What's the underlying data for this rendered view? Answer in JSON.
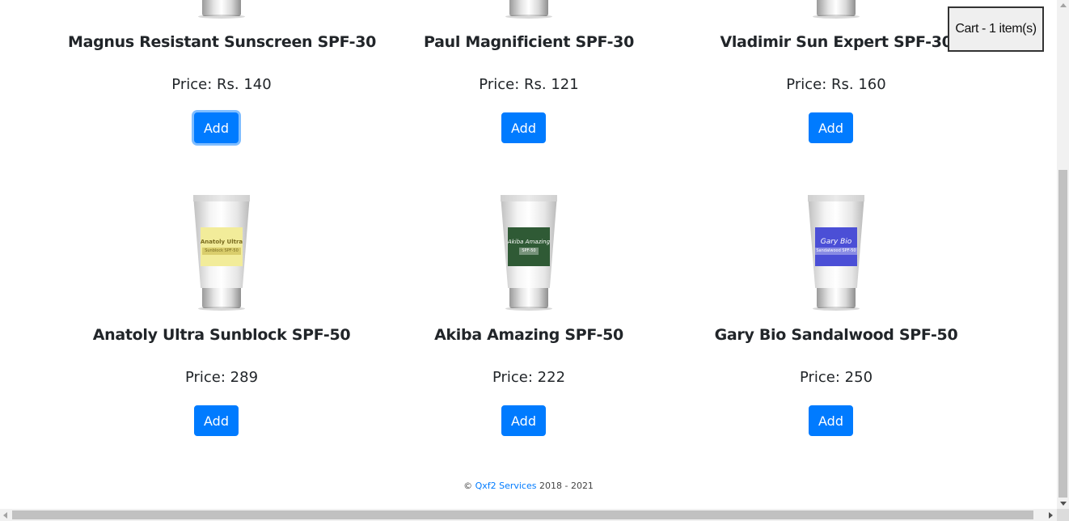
{
  "cart": {
    "label": "Cart - 1 item(s)"
  },
  "add_label": "Add",
  "products": [
    {
      "name": "Magnus Resistant Sunscreen SPF-30",
      "price": "Price: Rs. 140"
    },
    {
      "name": "Paul Magnificient SPF-30",
      "price": "Price: Rs. 121"
    },
    {
      "name": "Vladimir Sun Expert SPF-30",
      "price": "Price: Rs. 160"
    },
    {
      "name": "Anatoly Ultra Sunblock SPF-50",
      "price": "Price: 289",
      "tube_label": "Anatoly Ultra",
      "tube_sub": "Sunblock SPF-50",
      "tube_color": "#f2ec9a"
    },
    {
      "name": "Akiba Amazing SPF-50",
      "price": "Price: 222",
      "tube_label": "Akiba Amazing",
      "tube_sub": "SPF-50",
      "tube_color": "#2f5a35"
    },
    {
      "name": "Gary Bio Sandalwood SPF-50",
      "price": "Price: 250",
      "tube_label": "Gary Bio",
      "tube_sub": "Sandalwood SPF-50",
      "tube_color": "#4b4fd6"
    }
  ],
  "footer": {
    "copyright": "©",
    "link": "Qxf2 Services",
    "years": "2018 - 2021"
  }
}
